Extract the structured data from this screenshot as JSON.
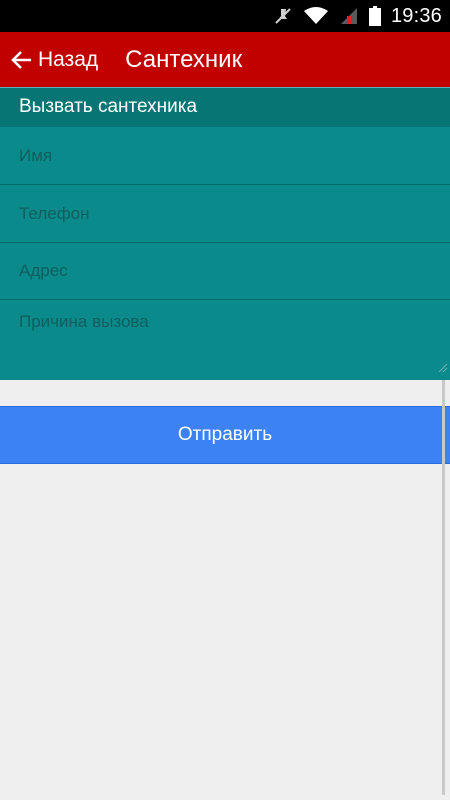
{
  "status_bar": {
    "time": "19:36",
    "icons": [
      "mute-icon",
      "wifi-icon",
      "signal-icon",
      "battery-icon"
    ]
  },
  "app_bar": {
    "back_label": "Назад",
    "title": "Сантехник",
    "background_color": "#c10000"
  },
  "form": {
    "header": "Вызвать сантехника",
    "fields": {
      "name": {
        "placeholder": "Имя",
        "value": ""
      },
      "phone": {
        "placeholder": "Телефон",
        "value": ""
      },
      "address": {
        "placeholder": "Адрес",
        "value": ""
      },
      "reason": {
        "placeholder": "Причина вызова",
        "value": ""
      }
    },
    "background_color": "#0a8a8a"
  },
  "submit": {
    "label": "Отправить",
    "color": "#3c82f5"
  }
}
